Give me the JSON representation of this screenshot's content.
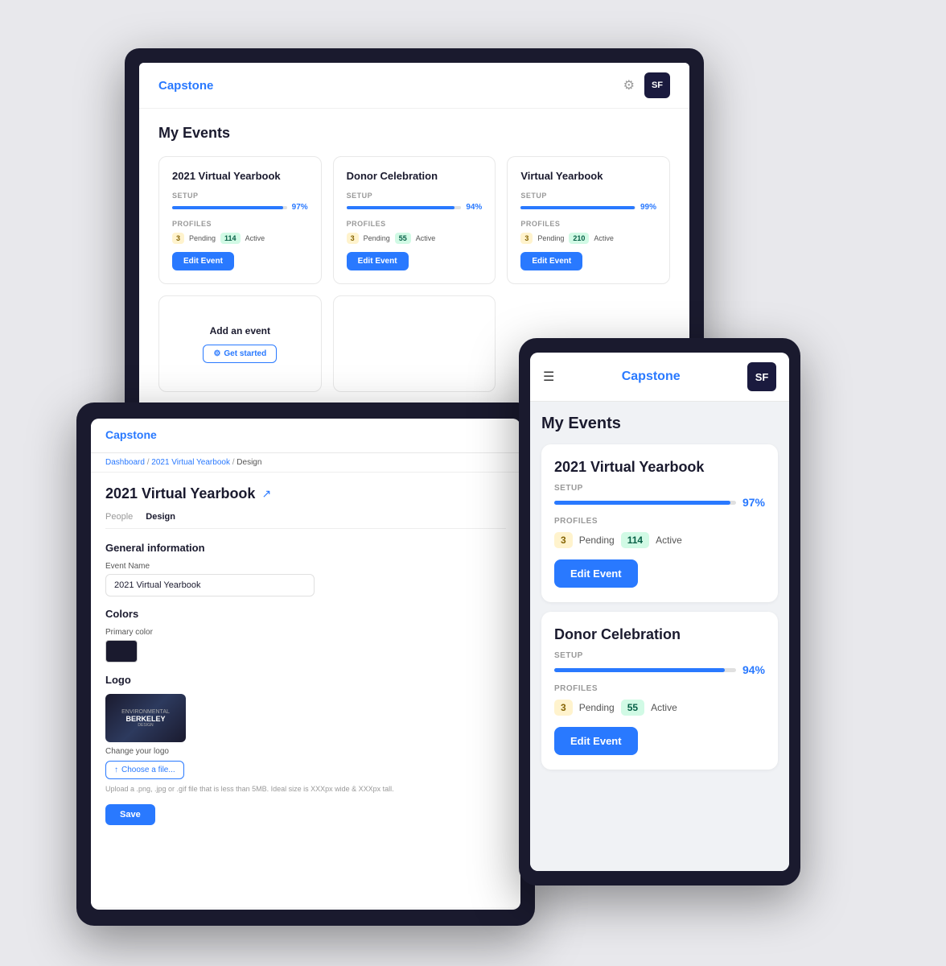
{
  "app": {
    "logo": "Capstone",
    "avatar": "SF"
  },
  "laptop": {
    "page_title": "My Events",
    "events": [
      {
        "title": "2021 Virtual Yearbook",
        "setup_label": "SETUP",
        "progress": 97,
        "progress_pct": "97%",
        "profiles_label": "PROFILES",
        "pending_count": "3",
        "pending_label": "Pending",
        "active_count": "114",
        "active_label": "Active",
        "edit_btn": "Edit Event"
      },
      {
        "title": "Donor Celebration",
        "setup_label": "SETUP",
        "progress": 94,
        "progress_pct": "94%",
        "profiles_label": "PROFILES",
        "pending_count": "3",
        "pending_label": "Pending",
        "active_count": "55",
        "active_label": "Active",
        "edit_btn": "Edit Event"
      },
      {
        "title": "Virtual Yearbook",
        "setup_label": "SETUP",
        "progress": 99,
        "progress_pct": "99%",
        "profiles_label": "PROFILES",
        "pending_count": "3",
        "pending_label": "Pending",
        "active_count": "210",
        "active_label": "Active",
        "edit_btn": "Edit Event"
      }
    ],
    "add_event": {
      "title": "Add an event",
      "btn_label": "Get started"
    }
  },
  "tablet_left": {
    "logo": "Capstone",
    "breadcrumb": {
      "dashboard": "Dashboard",
      "event": "2021 Virtual Yearbook",
      "section": "Design"
    },
    "title": "2021 Virtual Yearbook",
    "tabs": [
      "People",
      "Design"
    ],
    "active_tab": "Design",
    "general_info": {
      "section_title": "General information",
      "event_name_label": "Event Name",
      "event_name_value": "2021 Virtual Yearbook"
    },
    "colors": {
      "section_title": "Colors",
      "primary_color_label": "Primary color"
    },
    "logo_section": {
      "section_title": "Logo",
      "change_logo_label": "Change your logo",
      "choose_file_btn": "Choose a file...",
      "upload_hint": "Upload a .png, .jpg or .gif file that is less than 5MB. Ideal size is XXXpx wide & XXXpx tall.",
      "save_btn": "Save"
    }
  },
  "tablet_right": {
    "logo": "Capstone",
    "avatar": "SF",
    "page_title": "My Events",
    "events": [
      {
        "title": "2021 Virtual Yearbook",
        "setup_label": "SETUP",
        "progress": 97,
        "progress_pct": "97%",
        "profiles_label": "PROFILES",
        "pending_count": "3",
        "pending_label": "Pending",
        "active_count": "114",
        "active_label": "Active",
        "edit_btn": "Edit Event"
      },
      {
        "title": "Donor Celebration",
        "setup_label": "SETUP",
        "progress": 94,
        "progress_pct": "94%",
        "profiles_label": "PROFILES",
        "pending_count": "3",
        "pending_label": "Pending",
        "active_count": "55",
        "active_label": "Active",
        "edit_btn": "Edit Event"
      }
    ]
  }
}
